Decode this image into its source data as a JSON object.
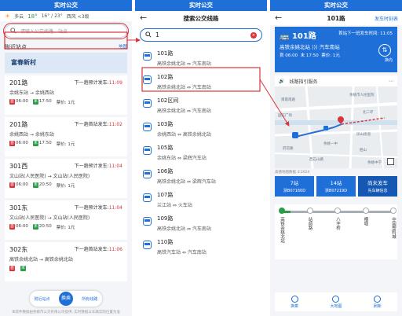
{
  "panel1": {
    "title": "实时公交",
    "weather": {
      "city": "多云",
      "temp": "18°",
      "range": "16° / 23°",
      "wind": "西风 <3级"
    },
    "search_placeholder": "请输入公交线路、站点",
    "nearby_label": "附近站点",
    "map_label": "地图",
    "stop_name": "富春新村",
    "cards": [
      {
        "route": "201路",
        "hint": "下一趟预计发车:",
        "hint_time": "11:09",
        "path": "余姚东站 → 余姚西站",
        "first": "首",
        "first_time": "06:00",
        "last": "末",
        "last_time": "17:50",
        "fare": "票价: 1元"
      },
      {
        "route": "201路",
        "hint": "下一趟首站发车:",
        "hint_time": "11:02",
        "path": "余姚西站 → 余姚东站",
        "first": "首",
        "first_time": "06:00",
        "last": "末",
        "last_time": "17:50",
        "fare": "票价: 1元"
      },
      {
        "route": "301西",
        "hint": "下一趟预计发车:",
        "hint_time": "11:04",
        "path": "文山站(人民医院) → 文山站(人民医院)",
        "first": "首",
        "first_time": "06:00",
        "last": "末",
        "last_time": "20:50",
        "fare": "票价: 1元"
      },
      {
        "route": "301东",
        "hint": "下一趟预计发车:",
        "hint_time": "11:04",
        "path": "文山站(人民医院) → 文山站(人民医院)",
        "first": "首",
        "first_time": "06:00",
        "last": "末",
        "last_time": "20:50",
        "fare": "票价: 1元"
      },
      {
        "route": "302东",
        "hint": "下一趟首站发车:",
        "hint_time": "11:06",
        "path": "高铁余姚北站 → 高铁余姚北站",
        "first": "首",
        "first_time": "",
        "last": "末",
        "last_time": "",
        "fare": ""
      }
    ],
    "bottom": {
      "left": "附近站点",
      "mid": "换乘",
      "right": "所有线路"
    },
    "footnote": "本软件数据由余姚市公交有限公司提供, 实时数据以车辆实际位置为准"
  },
  "panel2": {
    "title": "实时公交",
    "nav": "搜索公交线路",
    "query": "1",
    "results": [
      {
        "name": "101路",
        "path": "高铁余姚北站 ⇔ 汽车南站"
      },
      {
        "name": "102路",
        "path": "高铁余姚北站 ⇔ 汽车南站"
      },
      {
        "name": "102区间",
        "path": "高铁余姚北站 ⇔ 汽车南站"
      },
      {
        "name": "103路",
        "path": "余姚西站 ⇔ 高铁余姚北站"
      },
      {
        "name": "105路",
        "path": "余姚东站 ⇔ 梁辉汽车站"
      },
      {
        "name": "106路",
        "path": "高铁余姚北站 ⇔ 梁辉汽车站"
      },
      {
        "name": "107路",
        "path": "兰江站 ⇔ 火车站"
      },
      {
        "name": "109路",
        "path": "高铁余姚北站 ⇔ 汽车南站"
      },
      {
        "name": "110路",
        "path": "高铁汽车站 ⇔ 汽车南站"
      }
    ]
  },
  "panel3": {
    "title": "实时公交",
    "nav": "101路",
    "nav_right": "发车时刻表",
    "route": "101路",
    "next": "首站下一班发车时间: 11:05",
    "direction": "高铁余姚北站 ⟩⟩⟩ 汽车南站",
    "first": "首 06:00",
    "last": "末 17:50",
    "fare": "票价: 1元",
    "swap": "换向",
    "service": "线路指引服务",
    "map_pois": [
      "余姚市人民医院",
      "南雷南路",
      "北二环",
      "国信广场",
      "凤山街道",
      "余姚一中",
      "府前路",
      "胜山",
      "西石山路",
      "余姚中学"
    ],
    "map_note": "高德地图数据 ©2024",
    "buses": [
      {
        "a": "7站",
        "b": "浙B07160D"
      },
      {
        "a": "14站",
        "b": "浙B07219D"
      },
      {
        "a": "尚未发车",
        "b": "先车辆信息"
      }
    ],
    "stations": [
      "高铁余姚北站",
      "站前路",
      "八字桥",
      "横堰",
      "中国塑料城"
    ],
    "bottom": {
      "a": "换乘",
      "b": "大地图",
      "c": "刷新"
    }
  },
  "colors": {
    "brand": "#1f6fd8",
    "alert": "#d9343a",
    "ok": "#2b9c48"
  }
}
